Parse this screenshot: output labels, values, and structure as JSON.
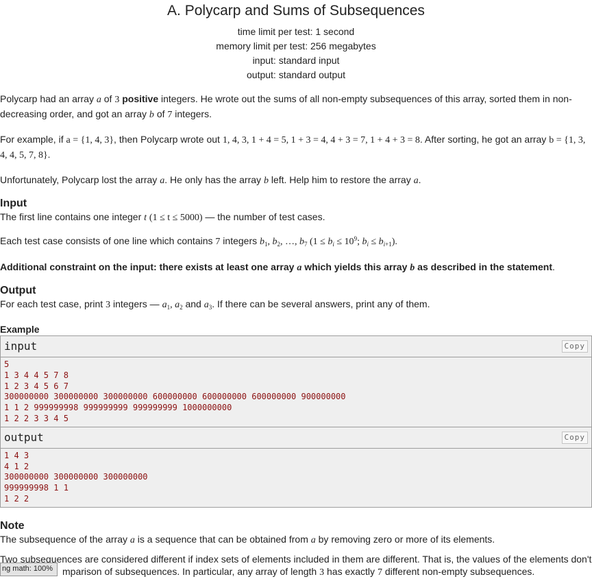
{
  "problem": {
    "title": "A. Polycarp and Sums of Subsequences",
    "limits": [
      "time limit per test: 1 second",
      "memory limit per test: 256 megabytes",
      "input: standard input",
      "output: standard output"
    ]
  },
  "statement": {
    "p1_a": "Polycarp had an array",
    "p1_b": "of",
    "p1_c": "positive",
    "p1_d": "integers. He wrote out the sums of all non-empty subsequences of this array, sorted them in non-decreasing order, and got an array",
    "p1_e": "of",
    "p1_f": "integers.",
    "p2_a": "For example, if",
    "p2_b": ", then Polycarp wrote out",
    "p2_c": ". After sorting, he got an array",
    "p3_a": "Unfortunately, Polycarp lost the array",
    "p3_b": ". He only has the array",
    "p3_c": "left. Help him to restore the array"
  },
  "input_section": {
    "heading": "Input",
    "line1_a": "The first line contains one integer",
    "line1_b": "— the number of test cases.",
    "line2_a": "Each test case consists of one line which contains",
    "line2_b": "integers",
    "constraint_a": "Additional constraint on the input: there exists at least one array",
    "constraint_b": "which yields this array",
    "constraint_c": "as described in the statement"
  },
  "output_section": {
    "heading": "Output",
    "line_a": "For each test case, print",
    "line_b": "integers —",
    "line_c": "and",
    "line_d": ". If there can be several answers, print any of them."
  },
  "example": {
    "heading": "Example",
    "input_label": "input",
    "output_label": "output",
    "copy_label": "Copy",
    "input_lines": [
      "5",
      "1 3 4 4 5 7 8",
      "1 2 3 4 5 6 7",
      "300000000 300000000 300000000 600000000 600000000 600000000 900000000",
      "1 1 2 999999998 999999999 999999999 1000000000",
      "1 2 2 3 3 4 5"
    ],
    "output_lines": [
      "1 4 3",
      "4 1 2",
      "300000000 300000000 300000000",
      "999999998 1 1",
      "1 2 2"
    ]
  },
  "note_section": {
    "heading": "Note",
    "line1_a": "The subsequence of the array",
    "line1_b": "is a sequence that can be obtained from",
    "line1_c": "by removing zero or more of its elements.",
    "line2_a": "Two subsequences are considered different if index sets of elements included in them are different. That is, the values of the elements don't",
    "line2_b": "mparison of subsequences. In particular, any array of length",
    "line2_c": "has exactly",
    "line2_d": "different non-empty subsequences."
  },
  "math": {
    "a": "a",
    "b": "b",
    "three": "3",
    "seven": "7",
    "example_a": "a = {1, 4, 3}",
    "example_sums": "1, 4, 3, 1 + 4 = 5, 1 + 3 = 4, 4 + 3 = 7, 1 + 4 + 3 = 8",
    "example_b": "b = {1, 3, 4, 4, 5, 7, 8}.",
    "t": "t",
    "t_range": "(1 ≤ t ≤ 5000)",
    "b_seq_pre": "b",
    "b_seq_range_pre": "(1 ≤ b",
    "b_seq_range_mid": " ≤ 10",
    "b_seq_range_exp": "9",
    "b_seq_range_post": "; b",
    "b_seq_range_end": " ≤ b",
    "b_seq_close": ").",
    "a1": "a",
    "a2": "a",
    "a3": "a"
  },
  "status_badge": "ng math: 100%"
}
